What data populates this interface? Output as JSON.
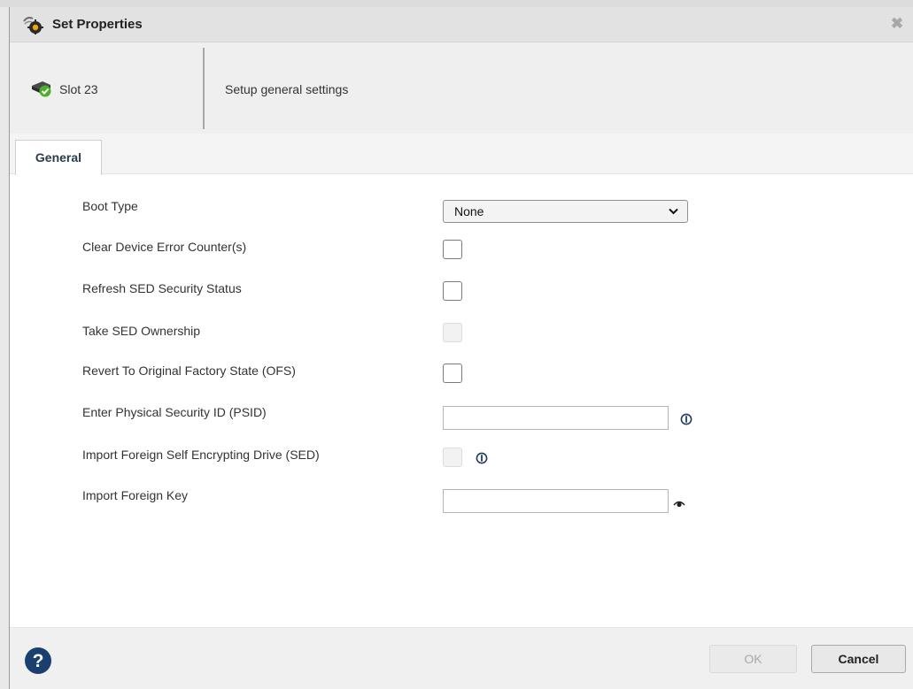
{
  "dialog": {
    "title": "Set Properties",
    "close_icon": "close-icon",
    "icons": {
      "title": "gear-dialog-icon",
      "slot": "drive-status-ok-icon"
    }
  },
  "header": {
    "slot_label": "Slot 23",
    "description": "Setup general settings"
  },
  "tabs": [
    {
      "label": "General",
      "active": true
    }
  ],
  "form": {
    "boot_type": {
      "label": "Boot Type",
      "value": "None",
      "options": [
        "None"
      ]
    },
    "clear_error": {
      "label": "Clear Device Error Counter(s)",
      "checked": false,
      "disabled": false
    },
    "refresh_sed": {
      "label": "Refresh SED Security Status",
      "checked": false,
      "disabled": false
    },
    "take_ownership": {
      "label": "Take SED Ownership",
      "checked": false,
      "disabled": true
    },
    "revert_ofs": {
      "label": "Revert To Original Factory State (OFS)",
      "checked": false,
      "disabled": false
    },
    "psid": {
      "label": "Enter Physical Security ID (PSID)",
      "value": "",
      "placeholder": ""
    },
    "import_sed": {
      "label": "Import Foreign Self Encrypting Drive (SED)",
      "checked": false,
      "disabled": true
    },
    "foreign_key": {
      "label": "Import Foreign Key",
      "value": "",
      "placeholder": ""
    }
  },
  "footer": {
    "ok_label": "OK",
    "cancel_label": "Cancel",
    "ok_disabled": true
  },
  "colors": {
    "titlebar": "#e2e2e2",
    "header": "#efefef",
    "tab_text": "#2a3b4d",
    "help_icon": "#1b3f6e",
    "status_ok": "#4caf2a"
  }
}
